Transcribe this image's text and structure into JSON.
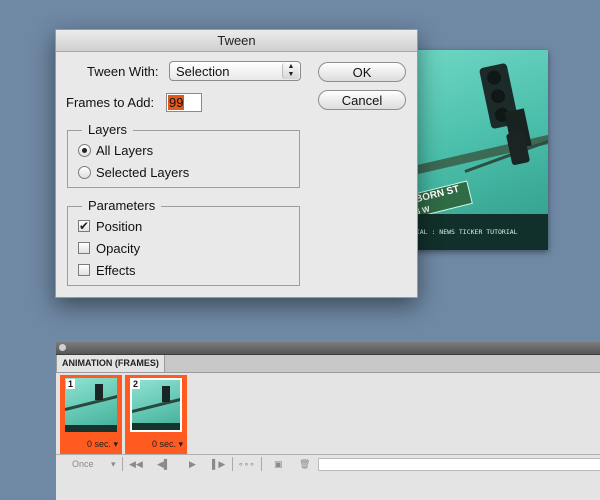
{
  "dialog": {
    "title": "Tween",
    "tween_with_label": "Tween With:",
    "tween_with_value": "Selection",
    "frames_label": "Frames to Add:",
    "frames_value": "99",
    "ok_label": "OK",
    "cancel_label": "Cancel",
    "layers_group": {
      "legend": "Layers",
      "options": [
        {
          "label": "All Layers",
          "selected": true
        },
        {
          "label": "Selected Layers",
          "selected": false
        }
      ]
    },
    "parameters_group": {
      "legend": "Parameters",
      "options": [
        {
          "label": "Position",
          "checked": true
        },
        {
          "label": "Opacity",
          "checked": false
        },
        {
          "label": "Effects",
          "checked": false
        }
      ]
    }
  },
  "canvas": {
    "sign_line1": "RBORN ST",
    "sign_line2": "36 W",
    "ticker_text": "ORIAL  :  NEWS TICKER TUTORIAL"
  },
  "animation_panel": {
    "tab_label": "ANIMATION (FRAMES)",
    "frames": [
      {
        "number": "1",
        "delay": "0 sec.",
        "selected": false
      },
      {
        "number": "2",
        "delay": "0 sec.",
        "selected": true
      }
    ],
    "loop_option": "Once",
    "accent_color": "#ff5a1f"
  },
  "icons": [
    "chevron-down-icon",
    "first-frame-icon",
    "previous-frame-icon",
    "play-icon",
    "next-frame-icon",
    "tween-icon",
    "new-frame-icon",
    "trash-icon"
  ]
}
